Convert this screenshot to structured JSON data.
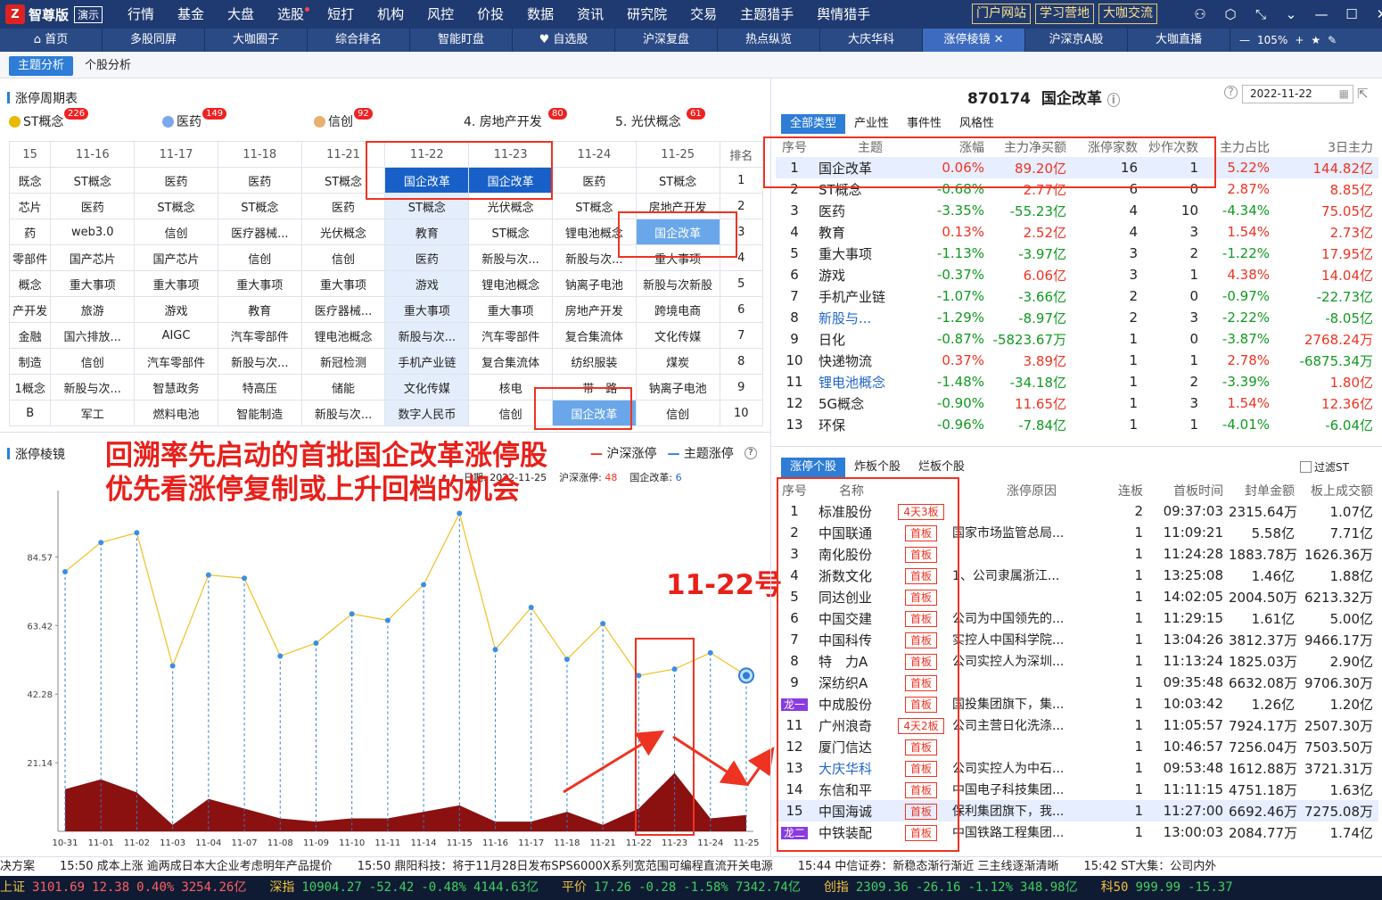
{
  "app": {
    "logo": "智尊版",
    "demo": "演示"
  },
  "menu": [
    "行情",
    "基金",
    "大盘",
    "选股",
    "短打",
    "机构",
    "风控",
    "价投",
    "数据",
    "资讯",
    "研究院",
    "交易",
    "主题猎手",
    "舆情猎手"
  ],
  "portal": [
    "门户网站",
    "学习营地",
    "大咖交流"
  ],
  "tabs": [
    "首页",
    "多股同屏",
    "大咖圈子",
    "综合排名",
    "智能盯盘",
    "自选股",
    "沪深复盘",
    "热点纵览",
    "大庆华科",
    "涨停棱镜",
    "沪深京A股",
    "大咖直播"
  ],
  "zoom": "105%",
  "subtabs": [
    "主题分析",
    "个股分析"
  ],
  "cycle_title": "涨停周期表",
  "topics": [
    {
      "name": "ST概念",
      "count": "226"
    },
    {
      "name": "医药",
      "count": "149"
    },
    {
      "name": "信创",
      "count": "92"
    },
    {
      "name": "4. 房地产开发",
      "count": "80"
    },
    {
      "name": "5. 光伏概念",
      "count": "61"
    }
  ],
  "cycle": {
    "dates": [
      "15",
      "11-16",
      "11-17",
      "11-18",
      "11-21",
      "11-22",
      "11-23",
      "11-24",
      "11-25",
      "排名"
    ],
    "rows": [
      [
        "既念",
        "ST概念",
        "医药",
        "医药",
        "ST概念",
        "国企改革",
        "国企改革",
        "医药",
        "ST概念",
        "1"
      ],
      [
        "芯片",
        "医药",
        "ST概念",
        "ST概念",
        "医药",
        "ST概念",
        "光伏概念",
        "ST概念",
        "房地产开发",
        "2"
      ],
      [
        "药",
        "web3.0",
        "信创",
        "医疗器械...",
        "光伏概念",
        "教育",
        "ST概念",
        "锂电池概念",
        "国企改革",
        "3"
      ],
      [
        "零部件",
        "国产芯片",
        "国产芯片",
        "信创",
        "信创",
        "医药",
        "新股与次...",
        "新股与次...",
        "重大事项",
        "4"
      ],
      [
        "概念",
        "重大事项",
        "重大事项",
        "重大事项",
        "重大事项",
        "游戏",
        "锂电池概念",
        "钠离子电池",
        "新股与次新股",
        "5"
      ],
      [
        "产开发",
        "旅游",
        "游戏",
        "教育",
        "医疗器械...",
        "重大事项",
        "重大事项",
        "房地产开发",
        "跨境电商",
        "6"
      ],
      [
        "金融",
        "国六排放...",
        "AIGC",
        "汽车零部件",
        "锂电池概念",
        "新股与次...",
        "汽车零部件",
        "复合集流体",
        "文化传媒",
        "7"
      ],
      [
        "制造",
        "信创",
        "汽车零部件",
        "新股与次...",
        "新冠检测",
        "手机产业链",
        "复合集流体",
        "纺织服装",
        "煤炭",
        "8"
      ],
      [
        "1概念",
        "新股与次...",
        "智慧政务",
        "特高压",
        "储能",
        "文化传媒",
        "核电",
        "一带一路",
        "钠离子电池",
        "9"
      ],
      [
        "B",
        "军工",
        "燃料电池",
        "智能制造",
        "新股与次...",
        "数字人民币",
        "信创",
        "国企改革",
        "信创",
        "10"
      ]
    ]
  },
  "annotations": {
    "main": [
      "回溯率先启动的首批国企改革涨停股",
      "优先看涨停复制或上升回档的机会"
    ],
    "date": "11-22号"
  },
  "prism": {
    "title": "涨停棱镜",
    "legend_a": "沪深涨停",
    "legend_b": "主题涨停",
    "info_date": "日期: 2022-11-25",
    "info_a_label": "沪深涨停:",
    "info_a": "48",
    "info_b_label": "国企改革:",
    "info_b": "6"
  },
  "chart_data": {
    "type": "line",
    "categories": [
      "10-31",
      "11-01",
      "11-02",
      "11-03",
      "11-04",
      "11-07",
      "11-08",
      "11-09",
      "11-10",
      "11-11",
      "11-14",
      "11-15",
      "11-16",
      "11-17",
      "11-18",
      "11-21",
      "11-22",
      "11-23",
      "11-24",
      "11-25"
    ],
    "series": [
      {
        "name": "沪深涨停",
        "type": "line",
        "color": "#f0c020",
        "values": [
          80,
          89,
          92,
          51,
          79,
          78,
          54,
          58,
          67,
          65,
          76,
          98,
          56,
          69,
          53,
          64,
          48,
          50,
          55,
          48
        ]
      },
      {
        "name": "主题涨停",
        "type": "area",
        "color": "#8b1010",
        "values": [
          13,
          16,
          12,
          2,
          10,
          7,
          4,
          3,
          4,
          4,
          6,
          8,
          3,
          3,
          6,
          2,
          7,
          18,
          4,
          5
        ]
      }
    ],
    "yticks": [
      "21.14",
      "42.28",
      "63.42",
      "84.57"
    ],
    "ylim": [
      0,
      105
    ]
  },
  "right": {
    "code": "870174",
    "name": "国企改革",
    "date": "2022-11-22",
    "tabs": [
      "全部类型",
      "产业性",
      "事件性",
      "风格性"
    ],
    "headers": [
      "序号",
      "主题",
      "涨幅",
      "主力净买额",
      "涨停家数",
      "炒作次数",
      "主力占比",
      "3日主力"
    ],
    "rows": [
      [
        "1",
        "国企改革",
        "0.06%",
        "89.20亿",
        "16",
        "1",
        "5.22%",
        "144.82亿"
      ],
      [
        "2",
        "ST概念",
        "-0.68%",
        "2.77亿",
        "6",
        "0",
        "2.87%",
        "8.85亿"
      ],
      [
        "3",
        "医药",
        "-3.35%",
        "-55.23亿",
        "4",
        "10",
        "-4.34%",
        "75.05亿"
      ],
      [
        "4",
        "教育",
        "0.13%",
        "2.52亿",
        "4",
        "3",
        "1.54%",
        "2.73亿"
      ],
      [
        "5",
        "重大事项",
        "-1.13%",
        "-3.97亿",
        "3",
        "2",
        "-1.22%",
        "17.95亿"
      ],
      [
        "6",
        "游戏",
        "-0.37%",
        "6.06亿",
        "3",
        "1",
        "4.38%",
        "14.04亿"
      ],
      [
        "7",
        "手机产业链",
        "-1.07%",
        "-3.66亿",
        "2",
        "0",
        "-0.97%",
        "-22.73亿"
      ],
      [
        "8",
        "新股与...",
        "-1.29%",
        "-8.97亿",
        "2",
        "3",
        "-2.22%",
        "-8.05亿"
      ],
      [
        "9",
        "日化",
        "-0.87%",
        "-5823.67万",
        "1",
        "0",
        "-3.87%",
        "2768.24万"
      ],
      [
        "10",
        "快递物流",
        "0.37%",
        "3.89亿",
        "1",
        "1",
        "2.78%",
        "-6875.34万"
      ],
      [
        "11",
        "锂电池概念",
        "-1.48%",
        "-34.18亿",
        "1",
        "2",
        "-3.39%",
        "1.80亿"
      ],
      [
        "12",
        "5G概念",
        "-0.90%",
        "11.65亿",
        "1",
        "3",
        "1.54%",
        "12.36亿"
      ],
      [
        "13",
        "环保",
        "-0.96%",
        "-7.84亿",
        "1",
        "1",
        "-4.01%",
        "-6.04亿"
      ]
    ]
  },
  "stocks": {
    "tabs": [
      "涨停个股",
      "炸板个股",
      "烂板个股"
    ],
    "filter": "过滤ST",
    "headers": [
      "序号",
      "名称",
      "",
      "涨停原因",
      "连板",
      "首板时间",
      "封单金额",
      "板上成交额"
    ],
    "rows": [
      [
        "1",
        "标准股份",
        "4天3板",
        "",
        "2",
        "09:37:03",
        "2315.64万",
        "1.07亿"
      ],
      [
        "2",
        "中国联通",
        "首板",
        "国家市场监管总局...",
        "1",
        "11:09:21",
        "5.58亿",
        "7.71亿"
      ],
      [
        "3",
        "南化股份",
        "首板",
        "",
        "1",
        "11:24:28",
        "1883.78万",
        "1626.36万"
      ],
      [
        "4",
        "浙数文化",
        "首板",
        "1、公司隶属浙江...",
        "1",
        "13:25:08",
        "1.46亿",
        "1.88亿"
      ],
      [
        "5",
        "同达创业",
        "首板",
        "",
        "1",
        "14:02:05",
        "2004.50万",
        "6213.32万"
      ],
      [
        "6",
        "中国交建",
        "首板",
        "公司为中国领先的...",
        "1",
        "11:29:15",
        "1.61亿",
        "5.00亿"
      ],
      [
        "7",
        "中国科传",
        "首板",
        "实控人中国科学院...",
        "1",
        "13:04:26",
        "3812.37万",
        "9466.17万"
      ],
      [
        "8",
        "特　力A",
        "首板",
        "公司实控人为深圳...",
        "1",
        "11:13:24",
        "1825.03万",
        "2.90亿"
      ],
      [
        "9",
        "深纺织A",
        "首板",
        "",
        "1",
        "09:35:48",
        "6632.08万",
        "9706.30万"
      ],
      [
        "龙一",
        "中成股份",
        "首板",
        "国投集团旗下，集...",
        "1",
        "10:03:42",
        "1.26亿",
        "1.20亿"
      ],
      [
        "11",
        "广州浪奇",
        "4天2板",
        "公司主营日化洗涤...",
        "1",
        "11:05:57",
        "7924.17万",
        "2507.30万"
      ],
      [
        "12",
        "厦门信达",
        "首板",
        "",
        "1",
        "10:46:57",
        "7256.04万",
        "7503.50万"
      ],
      [
        "13",
        "大庆华科",
        "首板",
        "公司实控人为中石...",
        "1",
        "09:53:48",
        "1612.88万",
        "3721.31万"
      ],
      [
        "14",
        "东信和平",
        "首板",
        "中国电子科技集团...",
        "1",
        "11:11:15",
        "4751.18万",
        "1.63亿"
      ],
      [
        "15",
        "中国海诚",
        "首板",
        "保利集团旗下，我...",
        "1",
        "11:27:00",
        "6692.46万",
        "7275.08万"
      ],
      [
        "龙二",
        "中铁装配",
        "首板",
        "中国铁路工程集团...",
        "1",
        "13:00:03",
        "2084.77万",
        "1.74亿"
      ]
    ]
  },
  "ticker": [
    "决方案",
    "15:50  成本上涨 逾两成日本大企业考虑明年产品提价",
    "15:50  鼎阳科技：将于11月28日发布SPS6000X系列宽范围可编程直流开关电源",
    "15:44  中信证券：新稳态渐行渐近 三主线逐渐清晰",
    "15:42  ST大集：公司内外"
  ],
  "indices": [
    {
      "name": "上证",
      "v": "3101.69",
      "c": "12.38",
      "p": "0.40%",
      "a": "3254.26亿",
      "dir": "up"
    },
    {
      "name": "深指",
      "v": "10904.27",
      "c": "-52.42",
      "p": "-0.48%",
      "a": "4144.63亿",
      "dir": "dn"
    },
    {
      "name": "平价",
      "v": "17.26",
      "c": "-0.28",
      "p": "-1.58%",
      "a": "7342.74亿",
      "dir": "dn"
    },
    {
      "name": "创指",
      "v": "2309.36",
      "c": "-26.16",
      "p": "-1.12%",
      "a": "348.98亿",
      "dir": "dn"
    },
    {
      "name": "科50",
      "v": "999.99",
      "c": "-15.37",
      "p": "",
      "a": "",
      "dir": "dn"
    }
  ]
}
